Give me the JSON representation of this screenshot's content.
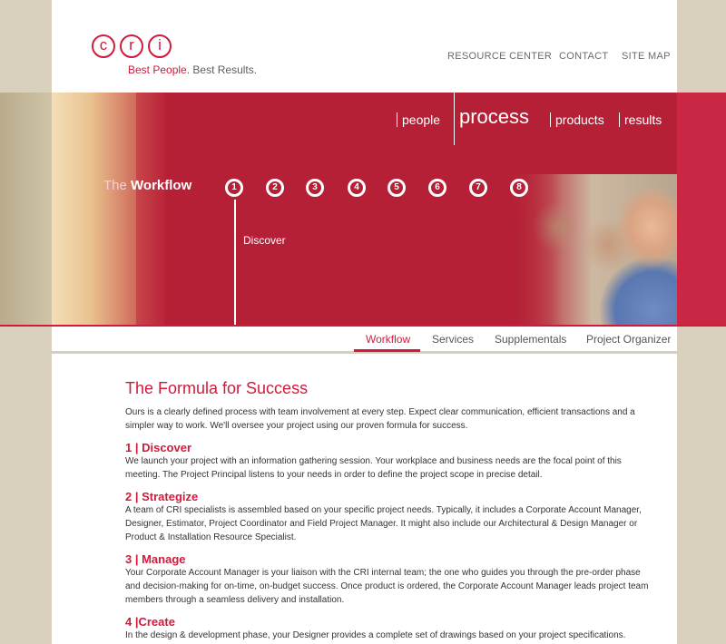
{
  "logo": {
    "letters": [
      "c",
      "r",
      "i"
    ],
    "tagline_a": "Best People.",
    "tagline_b": "Best Results."
  },
  "topnav": [
    "RESOURCE CENTER",
    "CONTACT",
    "SITE MAP"
  ],
  "mainnav": {
    "items": [
      "people",
      "process",
      "products",
      "results"
    ],
    "active": "process"
  },
  "workflow": {
    "title_a": "The",
    "title_b": "Workflow",
    "steps": [
      "1",
      "2",
      "3",
      "4",
      "5",
      "6",
      "7",
      "8"
    ],
    "current_label": "Discover"
  },
  "subnav": {
    "items": [
      "Workflow",
      "Services",
      "Supplementals",
      "Project Organizer"
    ],
    "active": "Workflow"
  },
  "content": {
    "title": "The Formula for Success",
    "intro": "Ours is a clearly defined process with team involvement at every step. Expect clear communication, efficient transactions and a simpler way to work. We'll oversee your project using our proven formula for success.",
    "sections": [
      {
        "heading": "1 | Discover",
        "body": "We launch your project with an information gathering session. Your workplace and business needs are the focal point of this meeting. The Project Principal listens to your needs in order to define the project scope in precise detail."
      },
      {
        "heading": "2 | Strategize",
        "body": "A team of CRI specialists is assembled based on your specific project needs. Typically, it includes a Corporate Account Manager, Designer, Estimator, Project Coordinator and Field Project Manager. It might also include our Architectural & Design Manager or Product & Installation Resource Specialist."
      },
      {
        "heading": "3 | Manage",
        "body": "Your Corporate Account Manager is your liaison with the CRI internal team; the one who guides you through the pre-order phase and decision-making for on-time, on-budget success. Once product is ordered, the Corporate Account Manager leads project team members through a seamless delivery and installation."
      },
      {
        "heading": "4 |Create",
        "body": "In the design & development phase, your Designer provides a complete set of drawings based on your project specifications."
      }
    ]
  },
  "colors": {
    "brand_red": "#d11a3b",
    "hero_red": "#b52036",
    "side_beige": "#d9d0bd"
  }
}
